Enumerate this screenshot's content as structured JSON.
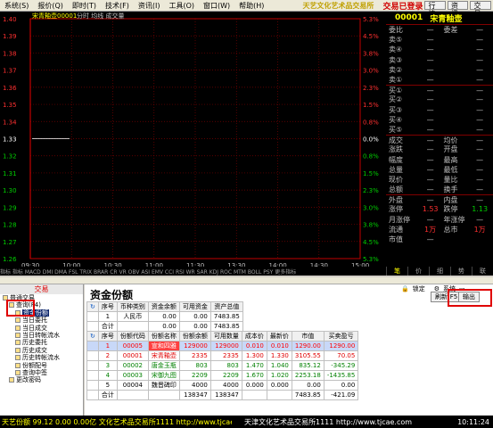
{
  "menu": {
    "items": [
      "系统(S)",
      "报价(Q)",
      "即时(T)",
      "技术(F)",
      "资讯(I)",
      "工具(O)",
      "窗口(W)",
      "帮助(H)"
    ],
    "brand": "天艺文化艺术品交易所",
    "login_status": "交易已登录",
    "right_buttons": [
      "行情",
      "资讯",
      "交易"
    ]
  },
  "chart": {
    "title_name": "宋青釉壶",
    "title_code": "00001",
    "title_mode": "分时 均线 成交量",
    "left_ticks": [
      "1.40",
      "1.39",
      "1.38",
      "1.37",
      "1.36",
      "1.35",
      "1.34",
      "1.33",
      "1.32",
      "1.31",
      "1.30",
      "1.29",
      "1.28",
      "1.27",
      "1.26"
    ],
    "right_ticks": [
      "5.3%",
      "4.5%",
      "3.8%",
      "3.0%",
      "2.3%",
      "1.5%",
      "0.8%",
      "0.0%",
      "0.8%",
      "1.5%",
      "2.3%",
      "3.0%",
      "3.8%",
      "4.5%",
      "5.3%"
    ],
    "time_labels": [
      "09:30",
      "10:00",
      "10:30",
      "11:00",
      "11:30",
      "13:30",
      "14:00",
      "14:30",
      "15:00"
    ],
    "price_line": 1.33,
    "colors": {
      "axis": "#c00000",
      "up": "#ff3030",
      "down": "#00d000",
      "flat": "#ffffff",
      "grid": "#7a0000"
    }
  },
  "quote": {
    "code": "00001",
    "name": "宋青釉壶",
    "rows_top": [
      {
        "l": "委比",
        "v": "—",
        "l2": "委差",
        "v2": "—"
      },
      {
        "l": "卖⑤",
        "v": "—",
        "v2": "—"
      },
      {
        "l": "卖④",
        "v": "—",
        "v2": "—"
      },
      {
        "l": "卖③",
        "v": "—",
        "v2": "—"
      },
      {
        "l": "卖②",
        "v": "—",
        "v2": "—"
      },
      {
        "l": "卖①",
        "v": "—",
        "v2": "—"
      }
    ],
    "rows_buy": [
      {
        "l": "买①",
        "v": "—",
        "v2": "—"
      },
      {
        "l": "买②",
        "v": "—",
        "v2": "—"
      },
      {
        "l": "买③",
        "v": "—",
        "v2": "—"
      },
      {
        "l": "买④",
        "v": "—",
        "v2": "—"
      },
      {
        "l": "买⑤",
        "v": "—",
        "v2": "—"
      }
    ],
    "rows_stats": [
      {
        "l": "成交",
        "v": "—",
        "l2": "均价",
        "v2": "—"
      },
      {
        "l": "涨跌",
        "v": "—",
        "l2": "开盘",
        "v2": "—"
      },
      {
        "l": "幅度",
        "v": "—",
        "l2": "最高",
        "v2": "—"
      },
      {
        "l": "总量",
        "v": "—",
        "l2": "最低",
        "v2": "—"
      },
      {
        "l": "现价",
        "v": "—",
        "l2": "量比",
        "v2": "—"
      },
      {
        "l": "总额",
        "v": "—",
        "l2": "换手",
        "v2": "—"
      }
    ],
    "rows_bottom": [
      {
        "l": "外盘",
        "v": "—",
        "l2": "内盘",
        "v2": "—"
      },
      {
        "l": "涨停",
        "v": "1.53",
        "l2": "跌停",
        "v2": "1.13"
      },
      {
        "l": "月涨停",
        "v": "—",
        "l2": "年涨停",
        "v2": "—"
      },
      {
        "l": "流通",
        "v": "1万",
        "l2": "总市",
        "v2": "1万"
      },
      {
        "l": "市值",
        "v": "—",
        "l2": "",
        "v2": ""
      }
    ]
  },
  "indicator_tabs": "指标 指标 MACD DMI DMA FSL TRIX BRAR CR VR OBV ASI EMV CCI RSI WR SAR KDJ ROC MTM BOLL PSY 更多指标",
  "right_tabs": [
    "笔",
    "价",
    "细",
    "势",
    "联"
  ],
  "trade": {
    "tree_title": "交易",
    "tree": [
      {
        "label": "普通交易",
        "indent": 0,
        "sel": false
      },
      {
        "label": "查询(F4)",
        "indent": 1,
        "sel": false
      },
      {
        "label": "资金份额",
        "indent": 2,
        "sel": true
      },
      {
        "label": "当日委托",
        "indent": 2,
        "sel": false
      },
      {
        "label": "当日成交",
        "indent": 2,
        "sel": false
      },
      {
        "label": "当日转帐流水",
        "indent": 2,
        "sel": false
      },
      {
        "label": "历史委托",
        "indent": 2,
        "sel": false
      },
      {
        "label": "历史成交",
        "indent": 2,
        "sel": false
      },
      {
        "label": "历史转帐流水",
        "indent": 2,
        "sel": false
      },
      {
        "label": "份额配号",
        "indent": 2,
        "sel": false
      },
      {
        "label": "查询中签",
        "indent": 2,
        "sel": false
      },
      {
        "label": "更改密码",
        "indent": 1,
        "sel": false
      }
    ],
    "panel_title": "资金份额",
    "btn_lock": "锁定",
    "btn_sys": "系统",
    "btn_refresh": "刷新(F5)",
    "btn_output": "输出",
    "funds_headers": [
      "序号",
      "币种类别",
      "资金余额",
      "可用资金",
      "资产总值"
    ],
    "funds_rows": [
      [
        "1",
        "人民币",
        "0.00",
        "0.00",
        "7483.85"
      ],
      [
        "合计",
        "",
        "0.00",
        "0.00",
        "7483.85"
      ]
    ],
    "shares_headers": [
      "序号",
      "份额代码",
      "份额名称",
      "份额余额",
      "可用数量",
      "成本价",
      "最新价",
      "市值",
      "买卖盈亏"
    ],
    "shares_rows": [
      {
        "cells": [
          "1",
          "00005",
          "宣和四雅",
          "129000",
          "129000",
          "0.010",
          "0.010",
          "1290.00",
          "1290.00"
        ],
        "color": "#ff0000",
        "sel": true
      },
      {
        "cells": [
          "2",
          "00001",
          "宋青釉壶",
          "2335",
          "2335",
          "1.300",
          "1.330",
          "3105.55",
          "70.05"
        ],
        "color": "#e00000",
        "sel": false
      },
      {
        "cells": [
          "3",
          "00002",
          "唐金玉瓶",
          "803",
          "803",
          "1.470",
          "1.040",
          "835.12",
          "-345.29"
        ],
        "color": "#008000",
        "sel": false
      },
      {
        "cells": [
          "4",
          "00003",
          "宋御九图",
          "2209",
          "2209",
          "1.670",
          "1.020",
          "2253.18",
          "-1435.85"
        ],
        "color": "#008000",
        "sel": false
      },
      {
        "cells": [
          "5",
          "00004",
          "魏晋碑印",
          "4000",
          "4000",
          "0.000",
          "0.000",
          "0.00",
          "0.00"
        ],
        "color": "#000000",
        "sel": false
      }
    ],
    "shares_total": [
      "合计",
      "",
      "",
      "138347",
      "138347",
      "",
      "",
      "7483.85",
      "-421.09"
    ]
  },
  "status": {
    "left": "天艺份额 99.12 0.00 0.00亿 文化艺术品交易所1111 http://www.tjcae.com",
    "mid": "天津文化艺术品交易所1111 http://www.tjcae.com",
    "time": "10:11:24"
  }
}
